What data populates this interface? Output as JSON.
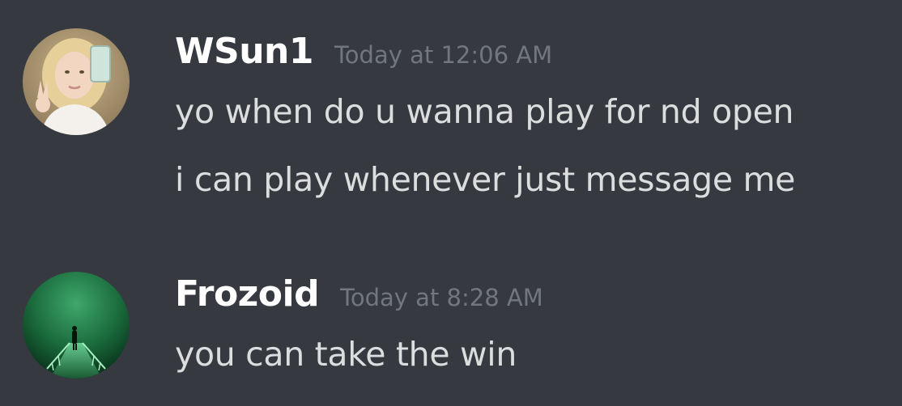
{
  "messages": [
    {
      "author": "WSun1",
      "timestamp": "Today at 12:06 AM",
      "avatar_icon": "user-avatar-photo",
      "lines": [
        "yo when do u wanna play for nd open",
        "i can play whenever just message me"
      ]
    },
    {
      "author": "Frozoid",
      "timestamp": "Today at 8:28 AM",
      "avatar_icon": "user-avatar-green-scene",
      "lines": [
        "you can take the win"
      ]
    }
  ],
  "colors": {
    "background": "#36393f",
    "username": "#ffffff",
    "message_text": "#dcddde",
    "timestamp": "#72767d"
  }
}
